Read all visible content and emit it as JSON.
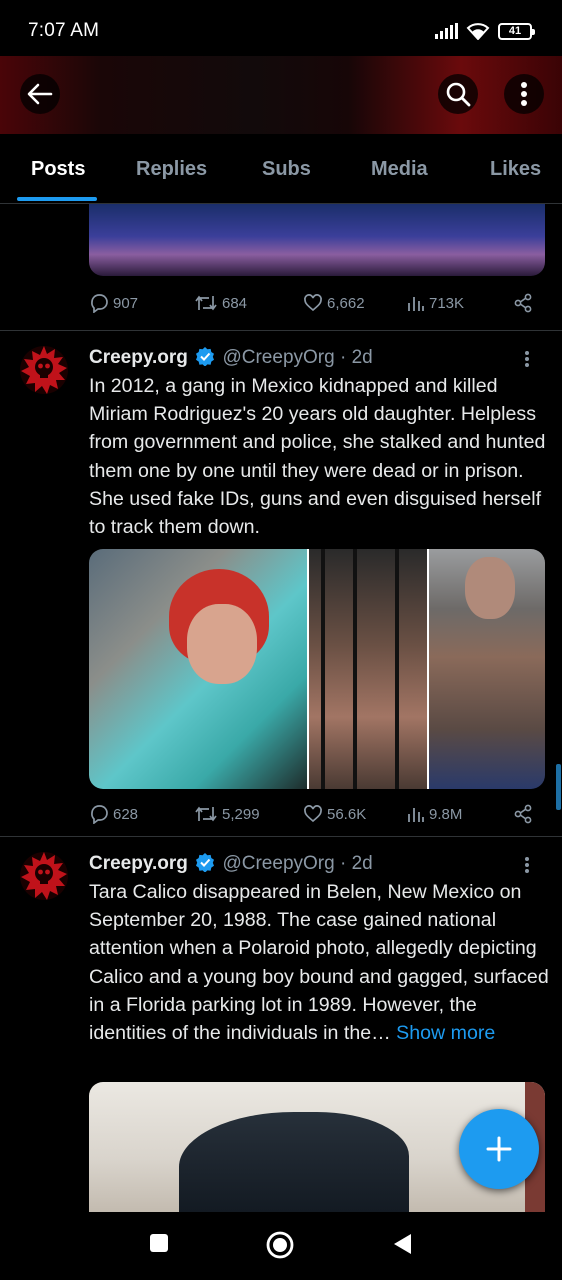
{
  "status_bar": {
    "time": "7:07 AM",
    "battery": "41"
  },
  "tabs": [
    {
      "label": "Posts",
      "active": true
    },
    {
      "label": "Replies",
      "active": false
    },
    {
      "label": "Subs",
      "active": false
    },
    {
      "label": "Media",
      "active": false
    },
    {
      "label": "Likes",
      "active": false
    }
  ],
  "colors": {
    "accent": "#1d9bf0",
    "background": "#000000",
    "muted": "#8b98a5",
    "text": "#e7e9ea"
  },
  "prev_tweet": {
    "replies": "907",
    "reposts": "684",
    "likes": "6,662",
    "views": "713K"
  },
  "tweets": [
    {
      "name": "Creepy.org",
      "handle": "@CreepyOrg",
      "time": "· 2d",
      "text": "In 2012, a gang in Mexico kidnapped and killed Miriam Rodriguez's 20 years old daughter. Helpless from government and police, she stalked and hunted them one by one until they were dead or in prison. She used fake IDs, guns and even disguised herself to track them down.",
      "replies": "628",
      "reposts": "5,299",
      "likes": "56.6K",
      "views": "9.8M"
    },
    {
      "name": "Creepy.org",
      "handle": "@CreepyOrg",
      "time": "· 2d",
      "text": "Tara Calico disappeared in Belen, New Mexico on September 20, 1988. The case gained national attention when a Polaroid photo, allegedly depicting Calico and a young boy bound and gagged, surfaced in a Florida parking lot in 1989. However, the identities of the individuals in the…",
      "show_more": "Show more"
    }
  ]
}
